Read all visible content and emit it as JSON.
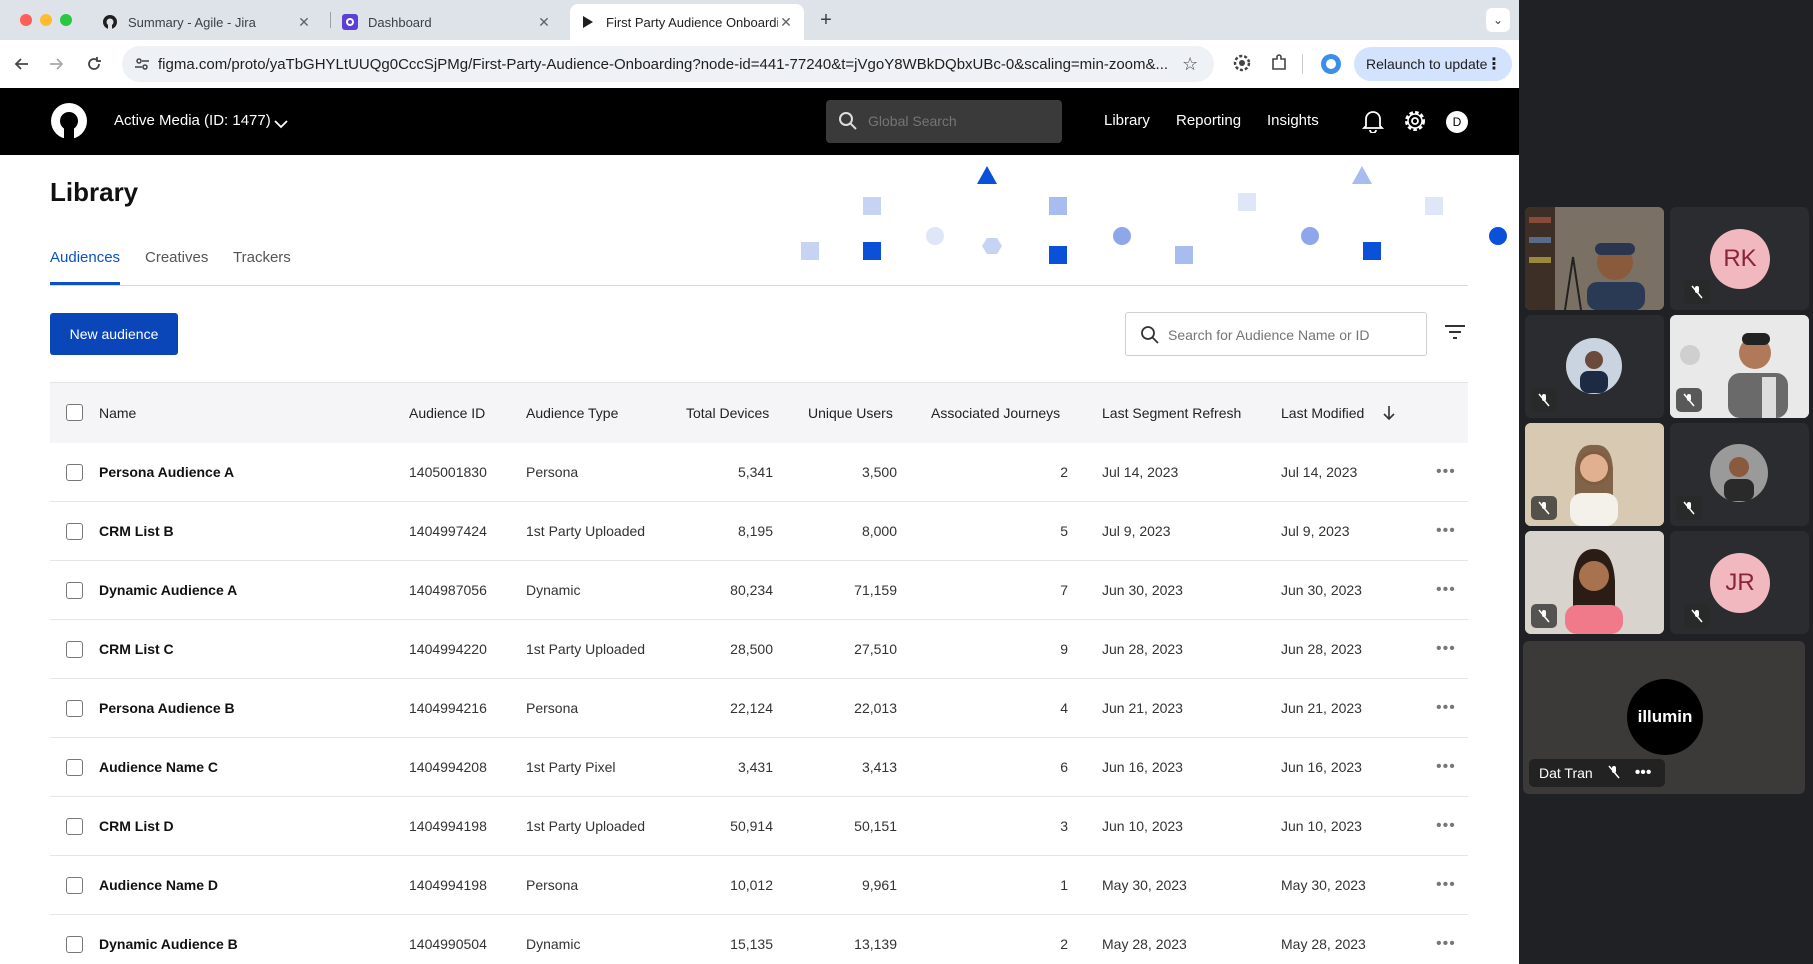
{
  "browser": {
    "tabs": [
      {
        "title": "Summary - Agile - Jira",
        "icon": "jira-icon"
      },
      {
        "title": "Dashboard",
        "icon": "dashboard-icon"
      },
      {
        "title": "First Party Audience Onboarding",
        "icon": "figma-play-icon"
      }
    ],
    "url": "figma.com/proto/yaTbGHYLtUUQg0CccSjPMg/First-Party-Audience-Onboarding?node-id=441-77240&t=jVgoY8WBkDQbxUBc-0&scaling=min-zoom&...",
    "relaunch_label": "Relaunch to update"
  },
  "header": {
    "account": "Active Media (ID: 1477)",
    "search_placeholder": "Global Search",
    "nav": [
      "Library",
      "Reporting",
      "Insights"
    ],
    "avatar_initial": "D"
  },
  "page": {
    "title": "Library",
    "tabs": [
      "Audiences",
      "Creatives",
      "Trackers"
    ],
    "active_tab": "Audiences",
    "new_button": "New audience",
    "search_placeholder": "Search for Audience Name or ID"
  },
  "table": {
    "columns": [
      "Name",
      "Audience ID",
      "Audience Type",
      "Total Devices",
      "Unique Users",
      "Associated Journeys",
      "Last Segment Refresh",
      "Last Modified"
    ],
    "sort_column": "Last Modified",
    "rows": [
      [
        "Persona Audience A",
        "1405001830",
        "Persona",
        "5,341",
        "3,500",
        "2",
        "Jul 14, 2023",
        "Jul 14, 2023"
      ],
      [
        "CRM List B",
        "1404997424",
        "1st Party Uploaded",
        "8,195",
        "8,000",
        "5",
        "Jul 9, 2023",
        "Jul 9, 2023"
      ],
      [
        "Dynamic Audience A",
        "1404987056",
        "Dynamic",
        "80,234",
        "71,159",
        "7",
        "Jun 30, 2023",
        "Jun 30, 2023"
      ],
      [
        "CRM List C",
        "1404994220",
        "1st Party Uploaded",
        "28,500",
        "27,510",
        "9",
        "Jun 28, 2023",
        "Jun 28, 2023"
      ],
      [
        "Persona Audience B",
        "1404994216",
        "Persona",
        "22,124",
        "22,013",
        "4",
        "Jun 21, 2023",
        "Jun 21, 2023"
      ],
      [
        "Audience Name C",
        "1404994208",
        "1st Party Pixel",
        "3,431",
        "3,413",
        "6",
        "Jun 16, 2023",
        "Jun 16, 2023"
      ],
      [
        "CRM List D",
        "1404994198",
        "1st Party Uploaded",
        "50,914",
        "50,151",
        "3",
        "Jun 10, 2023",
        "Jun 10, 2023"
      ],
      [
        "Audience Name D",
        "1404994198",
        "Persona",
        "10,012",
        "9,961",
        "1",
        "May 30, 2023",
        "May 30, 2023"
      ],
      [
        "Dynamic Audience B",
        "1404990504",
        "Dynamic",
        "15,135",
        "13,139",
        "2",
        "May 28, 2023",
        "May 28, 2023"
      ]
    ]
  },
  "meeting": {
    "initials_1": "RK",
    "initials_2": "JR",
    "logo_text": "illumin",
    "speaker_name": "Dat Tran"
  },
  "colors": {
    "brand_blue": "#0b46b8",
    "header_black": "#000000",
    "meeting_bg": "#202124"
  }
}
